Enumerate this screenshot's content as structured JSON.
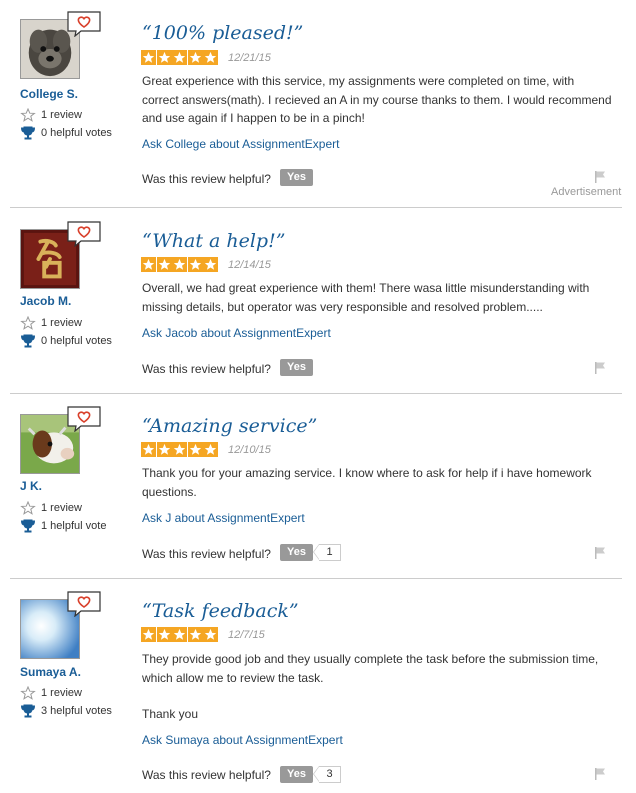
{
  "colors": {
    "link": "#1a5d96",
    "star": "#f5a623",
    "button": "#999999",
    "muted": "#999999"
  },
  "helpful_label": "Was this review helpful?",
  "yes_label": "Yes",
  "advertisement_label": "Advertisement",
  "reviews": [
    {
      "name": "College S.",
      "reviews_count": "1 review",
      "helpful_votes": "0 helpful votes",
      "title": "“100% pleased!”",
      "rating": 5,
      "date": "12/21/15",
      "body": [
        "Great experience with this service, my assignments were completed on time, with correct answers(math). I recieved an A in my course thanks to them. I would recommend and use again if I happen to be in a pinch!"
      ],
      "ask_link": "Ask College about AssignmentExpert",
      "helpful_count": "",
      "avatar_icon": "dog-photo"
    },
    {
      "name": "Jacob M.",
      "reviews_count": "1 review",
      "helpful_votes": "0 helpful votes",
      "title": "“What a help!”",
      "rating": 5,
      "date": "12/14/15",
      "body": [
        "Overall, we had great experience with them! There wasa little misunderstanding with missing details, but operator was very responsible and resolved problem....."
      ],
      "ask_link": "Ask Jacob about AssignmentExpert",
      "helpful_count": "",
      "avatar_icon": "calligraphy-photo"
    },
    {
      "name": "J K.",
      "reviews_count": "1 review",
      "helpful_votes": "1 helpful vote",
      "title": "“Amazing service”",
      "rating": 5,
      "date": "12/10/15",
      "body": [
        "Thank you for your amazing service. I know where to ask for help if i have homework questions."
      ],
      "ask_link": "Ask J about AssignmentExpert",
      "helpful_count": "1",
      "avatar_icon": "cow-photo"
    },
    {
      "name": "Sumaya A.",
      "reviews_count": "1 review",
      "helpful_votes": "3 helpful votes",
      "title": "“Task feedback”",
      "rating": 5,
      "date": "12/7/15",
      "body": [
        "They provide good job and they usually complete the task before the submission time, which allow me to review the task.",
        "Thank you"
      ],
      "ask_link": "Ask Sumaya about AssignmentExpert",
      "helpful_count": "3",
      "avatar_icon": "sky-photo"
    }
  ]
}
